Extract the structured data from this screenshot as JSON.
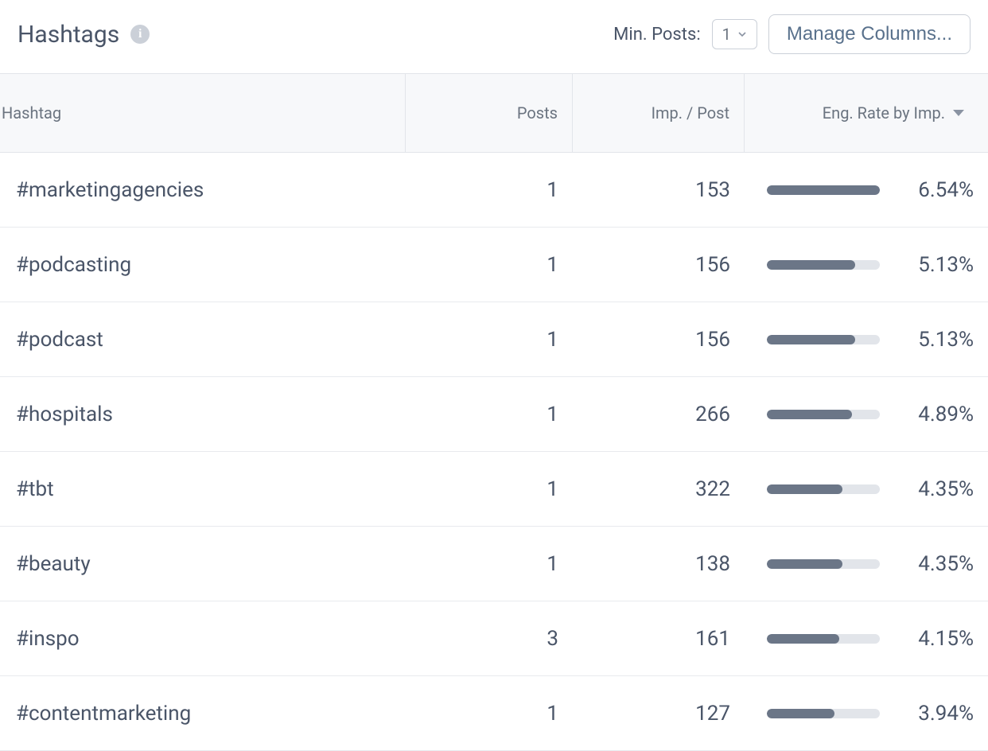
{
  "header": {
    "title": "Hashtags",
    "min_posts_label": "Min. Posts:",
    "min_posts_value": "1",
    "manage_columns_label": "Manage Columns..."
  },
  "columns": {
    "hashtag": "Hashtag",
    "posts": "Posts",
    "imp_per_post": "Imp. / Post",
    "eng_rate": "Eng. Rate by Imp."
  },
  "rows": [
    {
      "hashtag": "#marketingagencies",
      "posts": "1",
      "imp": "153",
      "eng": "6.54%",
      "bar": 100
    },
    {
      "hashtag": "#podcasting",
      "posts": "1",
      "imp": "156",
      "eng": "5.13%",
      "bar": 78
    },
    {
      "hashtag": "#podcast",
      "posts": "1",
      "imp": "156",
      "eng": "5.13%",
      "bar": 78
    },
    {
      "hashtag": "#hospitals",
      "posts": "1",
      "imp": "266",
      "eng": "4.89%",
      "bar": 75
    },
    {
      "hashtag": "#tbt",
      "posts": "1",
      "imp": "322",
      "eng": "4.35%",
      "bar": 67
    },
    {
      "hashtag": "#beauty",
      "posts": "1",
      "imp": "138",
      "eng": "4.35%",
      "bar": 67
    },
    {
      "hashtag": "#inspo",
      "posts": "3",
      "imp": "161",
      "eng": "4.15%",
      "bar": 64
    },
    {
      "hashtag": "#contentmarketing",
      "posts": "1",
      "imp": "127",
      "eng": "3.94%",
      "bar": 60
    }
  ]
}
